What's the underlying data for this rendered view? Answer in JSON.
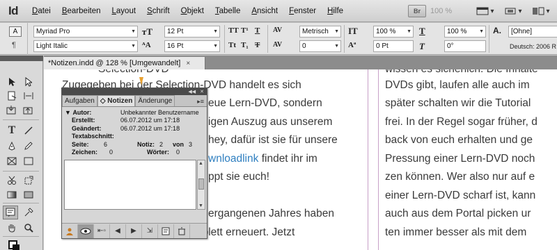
{
  "app": {
    "logo": "Id"
  },
  "menu": [
    "Datei",
    "Bearbeiten",
    "Layout",
    "Schrift",
    "Objekt",
    "Tabelle",
    "Ansicht",
    "Fenster",
    "Hilfe"
  ],
  "menubar_tools": {
    "bridge": "Br",
    "zoom": "100 %"
  },
  "control": {
    "font_family": "Myriad Pro",
    "font_style": "Light Italic",
    "font_size": "12 Pt",
    "leading": "16 Pt",
    "kerning": "Metrisch",
    "tracking": "0",
    "vertical_scale": "100 %",
    "horizontal_scale": "100 %",
    "baseline_shift": "0 Pt",
    "skew": "0°",
    "char_style": "[Ohne]",
    "language": "Deutsch: 2006 R"
  },
  "doc_tab": {
    "title": "*Notizen.indd @ 128 % [Umgewandelt]",
    "close": "×"
  },
  "document": {
    "left_column": [
      {
        "text": "Selection-DVD",
        "link": false
      },
      {
        "text": "Zugegeben bei der Selection-DVD handelt es sich",
        "link": false
      },
      {
        "text": "eue Lern-DVD, sondern",
        "link": false
      },
      {
        "text": "igen Auszug aus unserem",
        "link": false
      },
      {
        "text": "hey, dafür ist sie für unsere",
        "link": false
      },
      {
        "text_link": "wnloadlink",
        "text_after": " findet ihr im"
      },
      {
        "text": "ppt sie euch!",
        "link": false
      },
      {
        "text": "ergangenen Jahres haben",
        "link": false
      },
      {
        "text": "wir auch das DVD-Menü komplett erneuert. Jetzt",
        "link": false
      }
    ],
    "right_column": [
      "wissen es sicherlich. Die Inhalte",
      "DVDs gibt, laufen alle auch im",
      "später schalten wir die Tutorial",
      "frei. In der Regel sogar früher, d",
      "back von euch erhalten und ge",
      "Pressung einer Lern-DVD noch",
      "zen können. Wer also nur auf e",
      "einer Lern-DVD scharf ist, kann",
      "auch aus dem Portal picken ur",
      "ten immer besser als mit dem"
    ]
  },
  "notes_panel": {
    "tabs": [
      "Aufgaben",
      "Notizen",
      "Änderunge"
    ],
    "active_tab": "Notizen",
    "author_label": "Autor:",
    "author_value": "Unbekannter Benutzername",
    "created_label": "Erstellt:",
    "created_value": "06.07.2012 um 17:18",
    "modified_label": "Geändert:",
    "modified_value": "06.07.2012 um 17:18",
    "story_label": "Textabschnitt:",
    "page_label": "Seite:",
    "page_value": "6",
    "note_label": "Notiz:",
    "note_value": "2",
    "of_label": "von",
    "of_value": "3",
    "chars_label": "Zeichen:",
    "chars_value": "0",
    "words_label": "Wörter:",
    "words_value": "0"
  }
}
